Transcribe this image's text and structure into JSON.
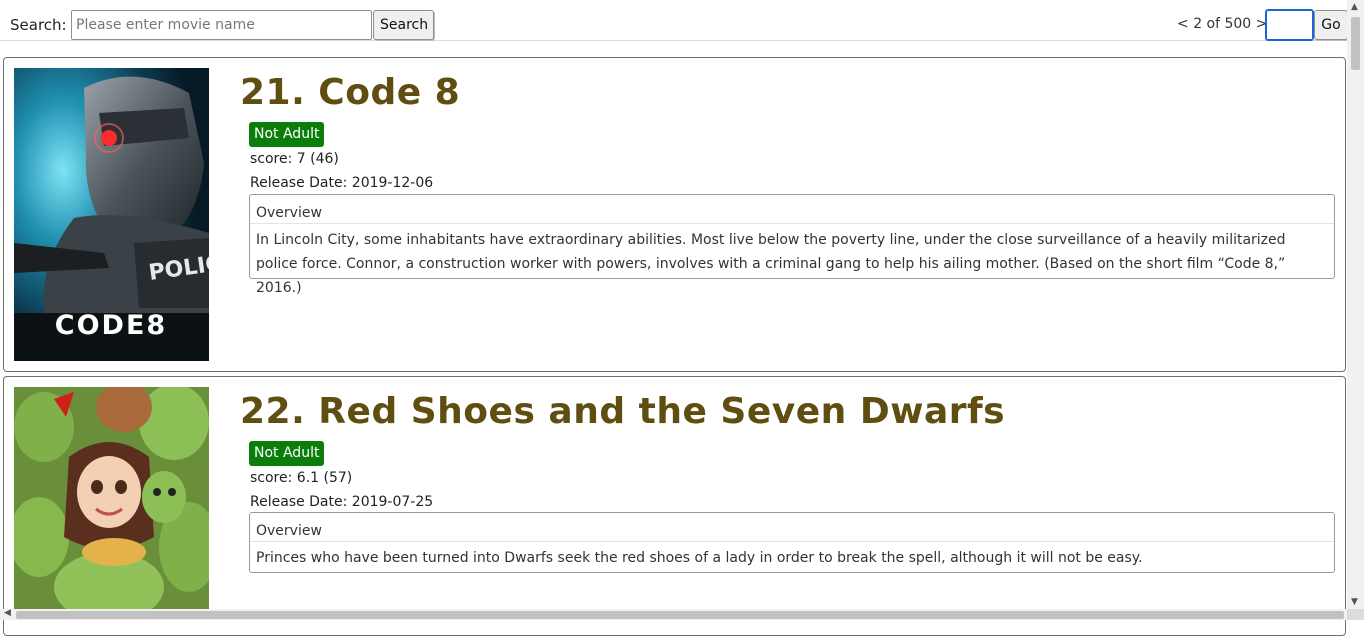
{
  "toolbar": {
    "search_label": "Search:",
    "search_placeholder": "Please enter movie name",
    "search_value": "",
    "search_button": "Search",
    "pager_prev": "<",
    "pager_text": "2 of 500",
    "pager_next": ">",
    "page_input_value": "",
    "go_button": "Go"
  },
  "movies": [
    {
      "title": "21. Code 8",
      "badge": "Not Adult",
      "score": "score: 7 (46)",
      "release": "Release Date: 2019-12-06",
      "overview_label": "Overview",
      "overview": "In Lincoln City, some inhabitants have extraordinary abilities. Most live below the poverty line, under the close surveillance of a heavily militarized police force. Connor, a construction worker with powers, involves with a criminal gang to help his ailing mother. (Based on the short film “Code 8,” 2016.)",
      "poster_text": "CODE8",
      "poster_badge_text": "POLICE"
    },
    {
      "title": "22. Red Shoes and the Seven Dwarfs",
      "badge": "Not Adult",
      "score": "score: 6.1 (57)",
      "release": "Release Date: 2019-07-25",
      "overview_label": "Overview",
      "overview": "Princes who have been turned into Dwarfs seek the red shoes of a lady in order to break the spell, although it will not be easy."
    }
  ],
  "colors": {
    "title": "#5f4e0f",
    "badge_bg": "#0b7d0b",
    "badge_text": "#ffffff"
  }
}
